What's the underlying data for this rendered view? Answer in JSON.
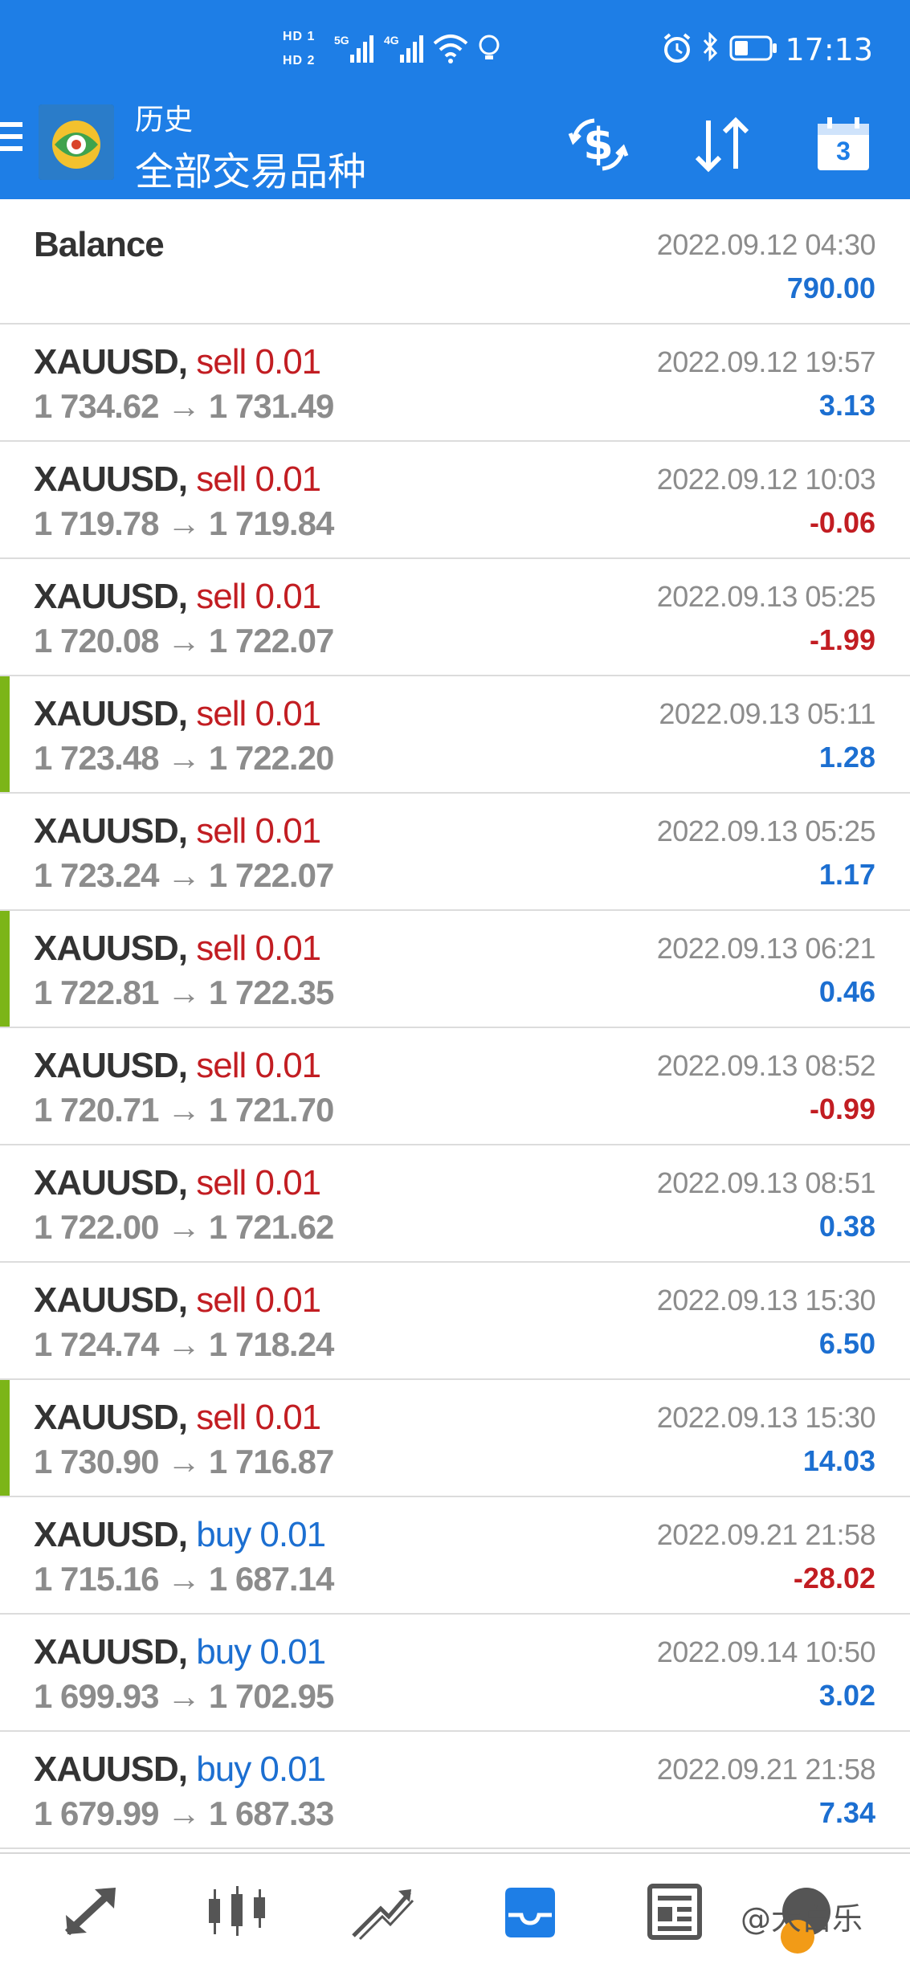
{
  "status_bar": {
    "hd1": "HD 1",
    "hd2": "HD 2",
    "net1": "5G",
    "net2": "4G",
    "time": "17:13"
  },
  "header": {
    "subtitle": "历史",
    "title": "全部交易品种"
  },
  "colors": {
    "header_bg": "#1e7ee6",
    "sell": "#c21d22",
    "buy": "#1c6fd1",
    "marker": "#7cb518",
    "muted": "#8c8c8c"
  },
  "balance": {
    "label": "Balance",
    "date": "2022.09.12 04:30",
    "amount": "790.00"
  },
  "trades": [
    {
      "symbol": "XAUUSD,",
      "side": "sell 0.01",
      "prices": "1 734.62 → 1 731.49",
      "date": "2022.09.12 19:57",
      "profit": "3.13"
    },
    {
      "symbol": "XAUUSD,",
      "side": "sell 0.01",
      "prices": "1 719.78 → 1 719.84",
      "date": "2022.09.12 10:03",
      "profit": "-0.06"
    },
    {
      "symbol": "XAUUSD,",
      "side": "sell 0.01",
      "prices": "1 720.08 → 1 722.07",
      "date": "2022.09.13 05:25",
      "profit": "-1.99"
    },
    {
      "symbol": "XAUUSD,",
      "side": "sell 0.01",
      "prices": "1 723.48 → 1 722.20",
      "date": "2022.09.13 05:11",
      "profit": "1.28"
    },
    {
      "symbol": "XAUUSD,",
      "side": "sell 0.01",
      "prices": "1 723.24 → 1 722.07",
      "date": "2022.09.13 05:25",
      "profit": "1.17"
    },
    {
      "symbol": "XAUUSD,",
      "side": "sell 0.01",
      "prices": "1 722.81 → 1 722.35",
      "date": "2022.09.13 06:21",
      "profit": "0.46"
    },
    {
      "symbol": "XAUUSD,",
      "side": "sell 0.01",
      "prices": "1 720.71 → 1 721.70",
      "date": "2022.09.13 08:52",
      "profit": "-0.99"
    },
    {
      "symbol": "XAUUSD,",
      "side": "sell 0.01",
      "prices": "1 722.00 → 1 721.62",
      "date": "2022.09.13 08:51",
      "profit": "0.38"
    },
    {
      "symbol": "XAUUSD,",
      "side": "sell 0.01",
      "prices": "1 724.74 → 1 718.24",
      "date": "2022.09.13 15:30",
      "profit": "6.50"
    },
    {
      "symbol": "XAUUSD,",
      "side": "sell 0.01",
      "prices": "1 730.90 → 1 716.87",
      "date": "2022.09.13 15:30",
      "profit": "14.03"
    },
    {
      "symbol": "XAUUSD,",
      "side": "buy 0.01",
      "prices": "1 715.16 → 1 687.14",
      "date": "2022.09.21 21:58",
      "profit": "-28.02"
    },
    {
      "symbol": "XAUUSD,",
      "side": "buy 0.01",
      "prices": "1 699.93 → 1 702.95",
      "date": "2022.09.14 10:50",
      "profit": "3.02"
    },
    {
      "symbol": "XAUUSD,",
      "side": "buy 0.01",
      "prices": "1 679.99 → 1 687.33",
      "date": "2022.09.21 21:58",
      "profit": "7.34"
    }
  ],
  "calendar_day": "3",
  "watermark": "@大白乐"
}
